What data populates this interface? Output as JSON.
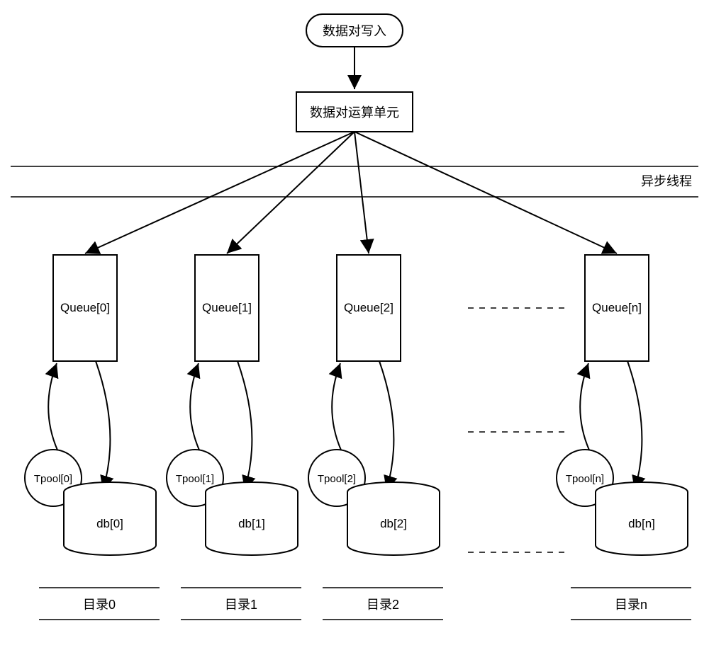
{
  "start_node": "数据对写入",
  "compute_node": "数据对运算单元",
  "async_label": "异步线程",
  "lanes": [
    {
      "queue": "Queue[0]",
      "tpool": "Tpool[0]",
      "db": "db[0]",
      "dir": "目录0"
    },
    {
      "queue": "Queue[1]",
      "tpool": "Tpool[1]",
      "db": "db[1]",
      "dir": "目录1"
    },
    {
      "queue": "Queue[2]",
      "tpool": "Tpool[2]",
      "db": "db[2]",
      "dir": "目录2"
    },
    {
      "queue": "Queue[n]",
      "tpool": "Tpool[n]",
      "db": "db[n]",
      "dir": "目录n"
    }
  ]
}
